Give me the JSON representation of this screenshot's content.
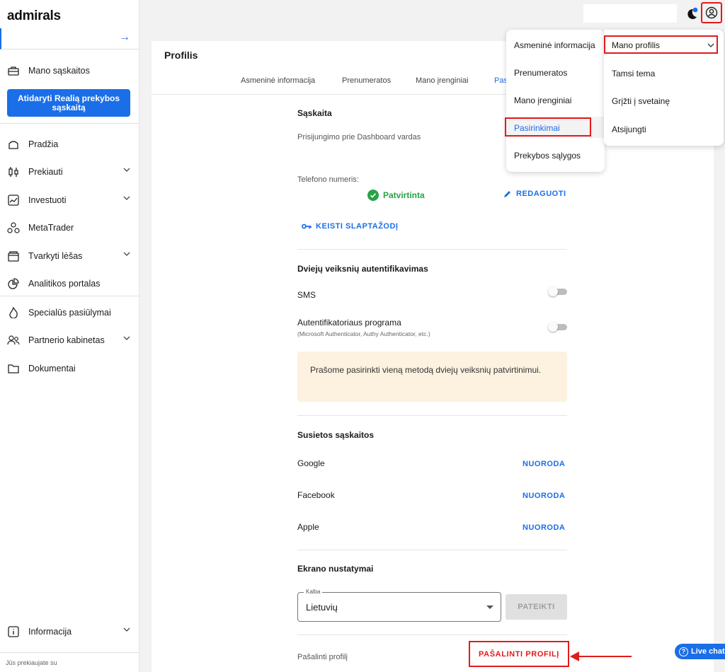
{
  "sidebar": {
    "logo": "admirals",
    "my_accounts": "Mano sąskaitos",
    "open_real_button": "Atidaryti Realią prekybos sąskaitą",
    "items": [
      {
        "label": "Pradžia",
        "icon": "home-icon"
      },
      {
        "label": "Prekiauti",
        "icon": "candlestick-icon"
      },
      {
        "label": "Investuoti",
        "icon": "chart-line-icon"
      },
      {
        "label": "MetaTrader",
        "icon": "metatrader-icon"
      },
      {
        "label": "Tvarkyti lėšas",
        "icon": "wallet-icon"
      },
      {
        "label": "Analitikos portalas",
        "icon": "pie-chart-icon"
      },
      {
        "label": "Specialūs pasiūlymai",
        "icon": "flame-icon"
      },
      {
        "label": "Partnerio kabinetas",
        "icon": "partners-icon"
      },
      {
        "label": "Dokumentai",
        "icon": "folder-icon"
      }
    ],
    "info": "Informacija",
    "footer": "Jūs prekiaujate su"
  },
  "profile": {
    "title": "Profilis",
    "tabs": [
      "Asmeninė informacija",
      "Prenumeratos",
      "Mano įrenginiai",
      "Pas"
    ],
    "account_section": "Sąskaita",
    "dashboard_name_label": "Prisijungimo prie Dashboard vardas",
    "phone_label": "Telefono numeris:",
    "phone_status": "Patvirtinta",
    "edit_button": "REDAGUOTI",
    "change_password": "KEISTI SLAPTAŽODĮ",
    "twofa_section": "Dviejų veiksnių autentifikavimas",
    "sms_label": "SMS",
    "auth_app_label": "Autentifikatoriaus programa",
    "auth_app_hint": "(Microsoft Authenticator, Authy Authenticator, etc.)",
    "twofa_notice": "Prašome pasirinkti vieną metodą dviejų veiksnių patvirtinimui.",
    "linked_section": "Susietos sąskaitos",
    "linked": [
      {
        "name": "Google",
        "action": "NUORODA"
      },
      {
        "name": "Facebook",
        "action": "NUORODA"
      },
      {
        "name": "Apple",
        "action": "NUORODA"
      }
    ],
    "screen_section": "Ekrano nustatymai",
    "language_legend": "Kalba",
    "language_value": "Lietuvių",
    "submit_button": "PATEIKTI",
    "delete_label": "Pašalinti profilį",
    "delete_button": "PAŠALINTI PROFILĮ"
  },
  "menu_left": {
    "items": [
      "Asmeninė informacija",
      "Prenumeratos",
      "Mano įrenginiai",
      "Pasirinkimai",
      "Prekybos sąlygos"
    ],
    "active_index": 3
  },
  "menu_right": {
    "items": [
      "Mano profilis",
      "Tamsi tema",
      "Grįžti į svetainę",
      "Atsijungti"
    ]
  },
  "live_chat": "Live chat",
  "colors": {
    "accent": "#1a6ee8",
    "success": "#27a347",
    "annotation": "#e21b1b"
  }
}
